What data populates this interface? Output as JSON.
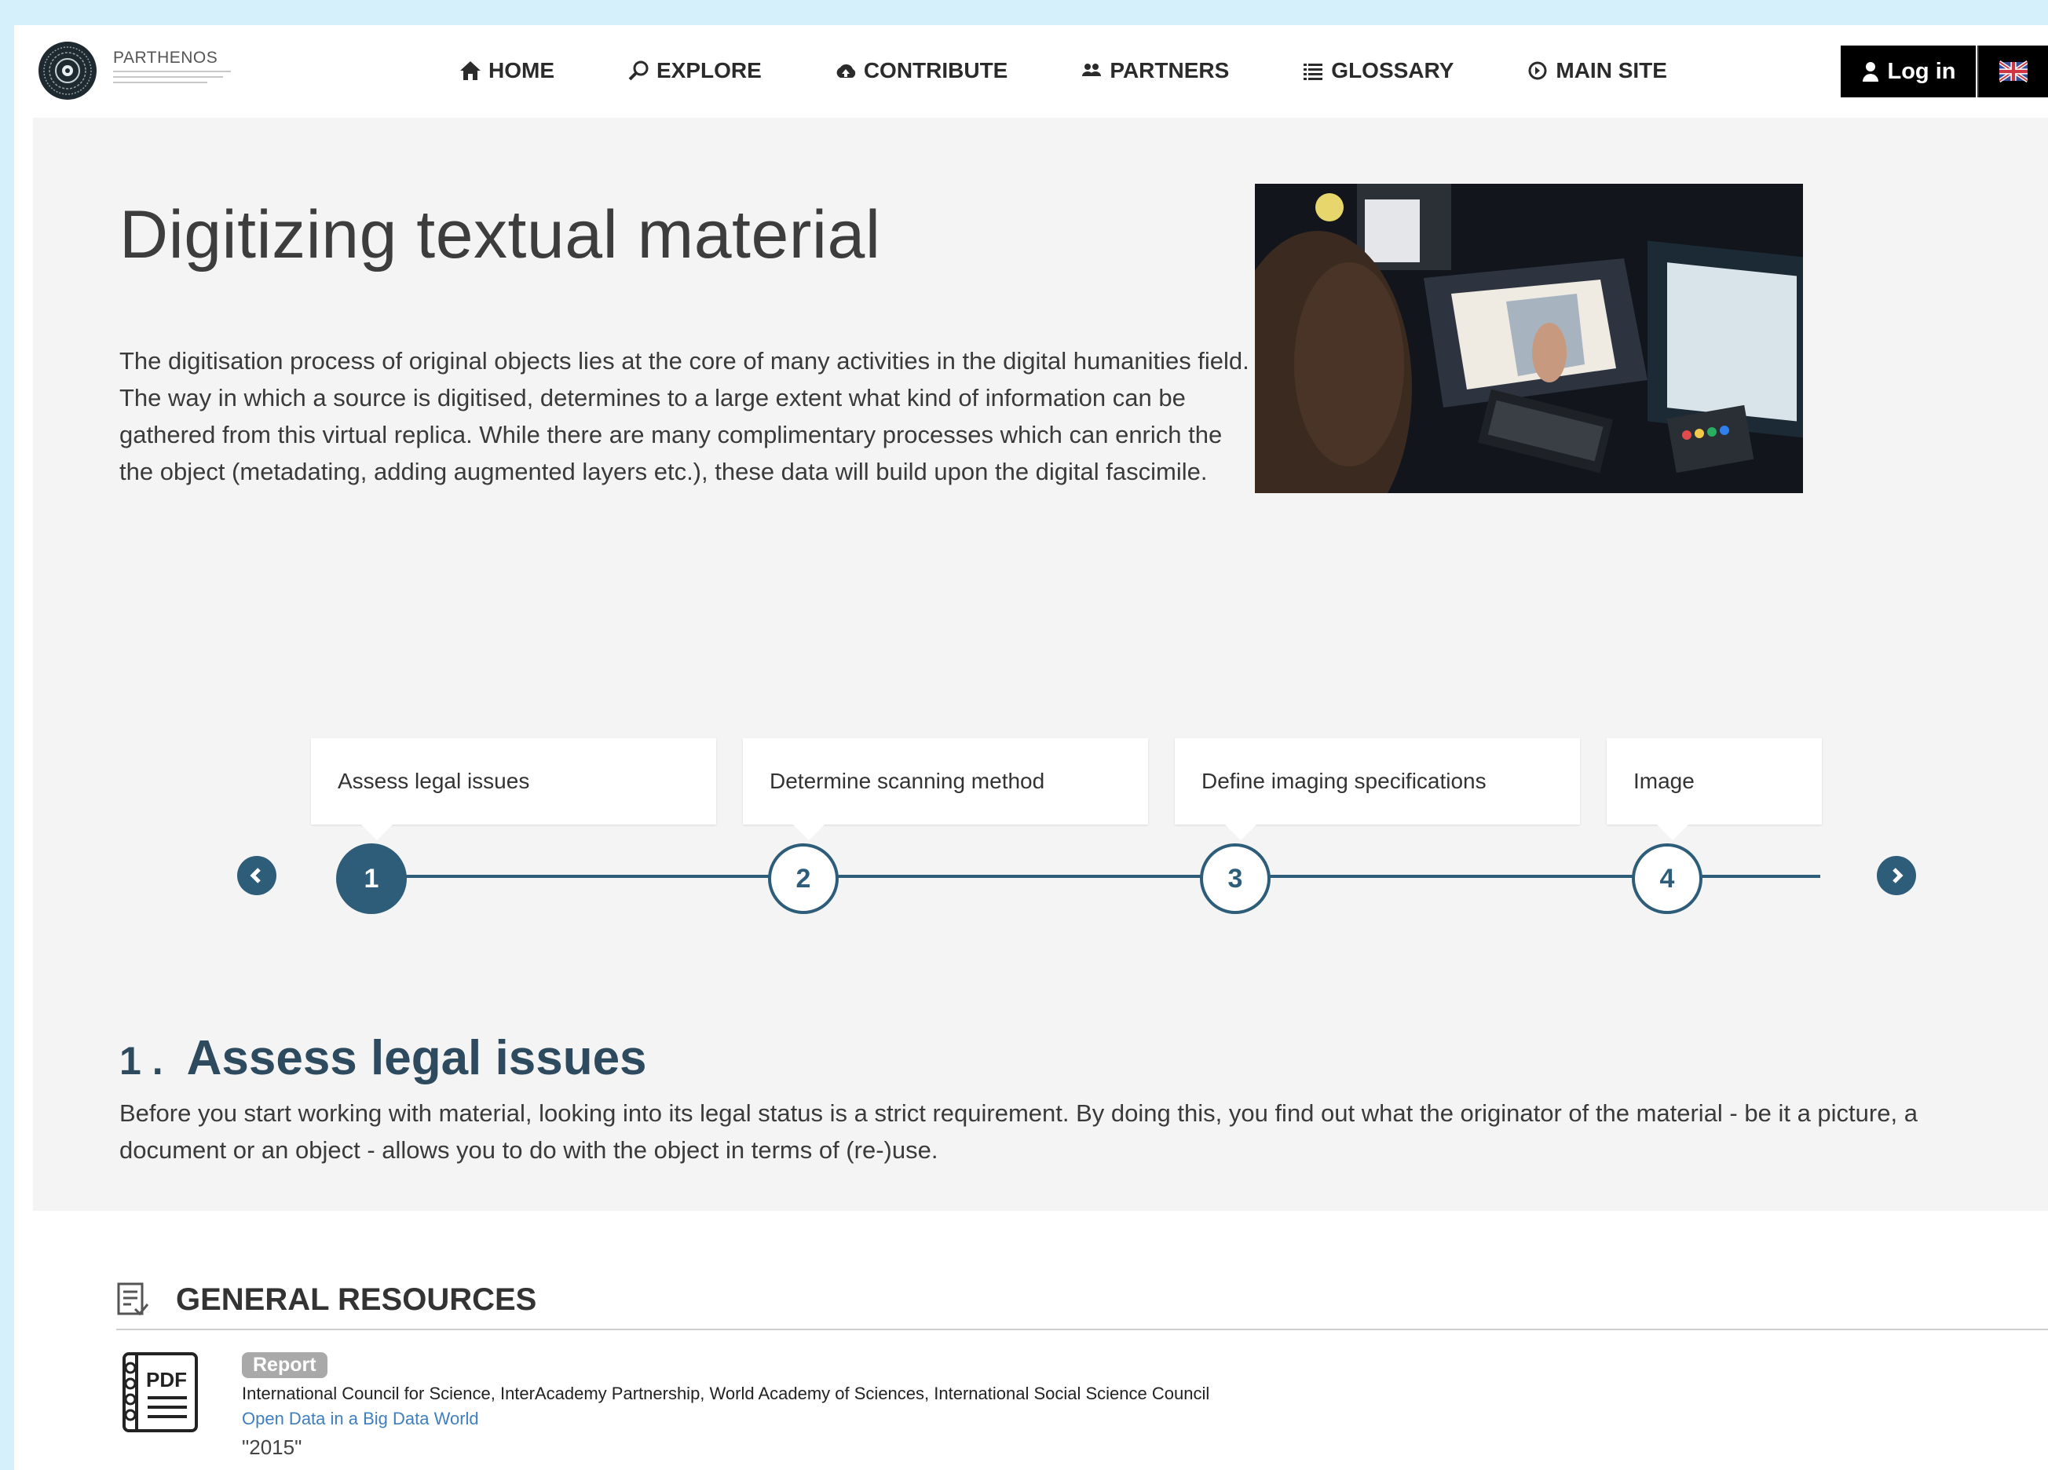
{
  "header": {
    "brand": "PARTHENOS",
    "nav": [
      {
        "label": "HOME",
        "icon": "home-icon"
      },
      {
        "label": "EXPLORE",
        "icon": "search-icon"
      },
      {
        "label": "CONTRIBUTE",
        "icon": "cloud-upload-icon"
      },
      {
        "label": "PARTNERS",
        "icon": "users-icon"
      },
      {
        "label": "GLOSSARY",
        "icon": "list-icon"
      },
      {
        "label": "MAIN SITE",
        "icon": "circle-arrow-icon"
      }
    ],
    "login_label": "Log in",
    "language_icon": "uk-flag-icon"
  },
  "hero": {
    "title": "Digitizing textual material",
    "intro": "The digitisation process of original objects lies at the core of many activities in the digital humanities field. The way in which a source is digitised, determines to a large extent what kind of information can be gathered from this virtual replica. While there are many complimentary processes which can enrich the the object (metadating, adding augmented layers etc.), these data will build upon the digital fascimile."
  },
  "timeline": {
    "steps": [
      {
        "number": "1",
        "label": "Assess legal issues",
        "active": true
      },
      {
        "number": "2",
        "label": "Determine scanning method",
        "active": false
      },
      {
        "number": "3",
        "label": "Define imaging specifications",
        "active": false
      },
      {
        "number": "4",
        "label": "Image",
        "active": false
      }
    ],
    "line_color": "#2e5d7a"
  },
  "current_step": {
    "number": "1 .",
    "title": "Assess legal issues",
    "description": "Before you start working with material, looking into its legal status is a strict requirement. By doing this, you find out what the originator of the material - be it a picture, a document or an object - allows you to do with the object in terms of (re-)use."
  },
  "resources": {
    "heading": "GENERAL RESOURCES",
    "items": [
      {
        "type": "Report",
        "icon_label": "PDF",
        "authors": "International Council for Science, InterAcademy Partnership, World Academy of Sciences, International Social Science Council",
        "title": "Open Data in a Big Data World",
        "year": "\"2015\""
      }
    ]
  }
}
